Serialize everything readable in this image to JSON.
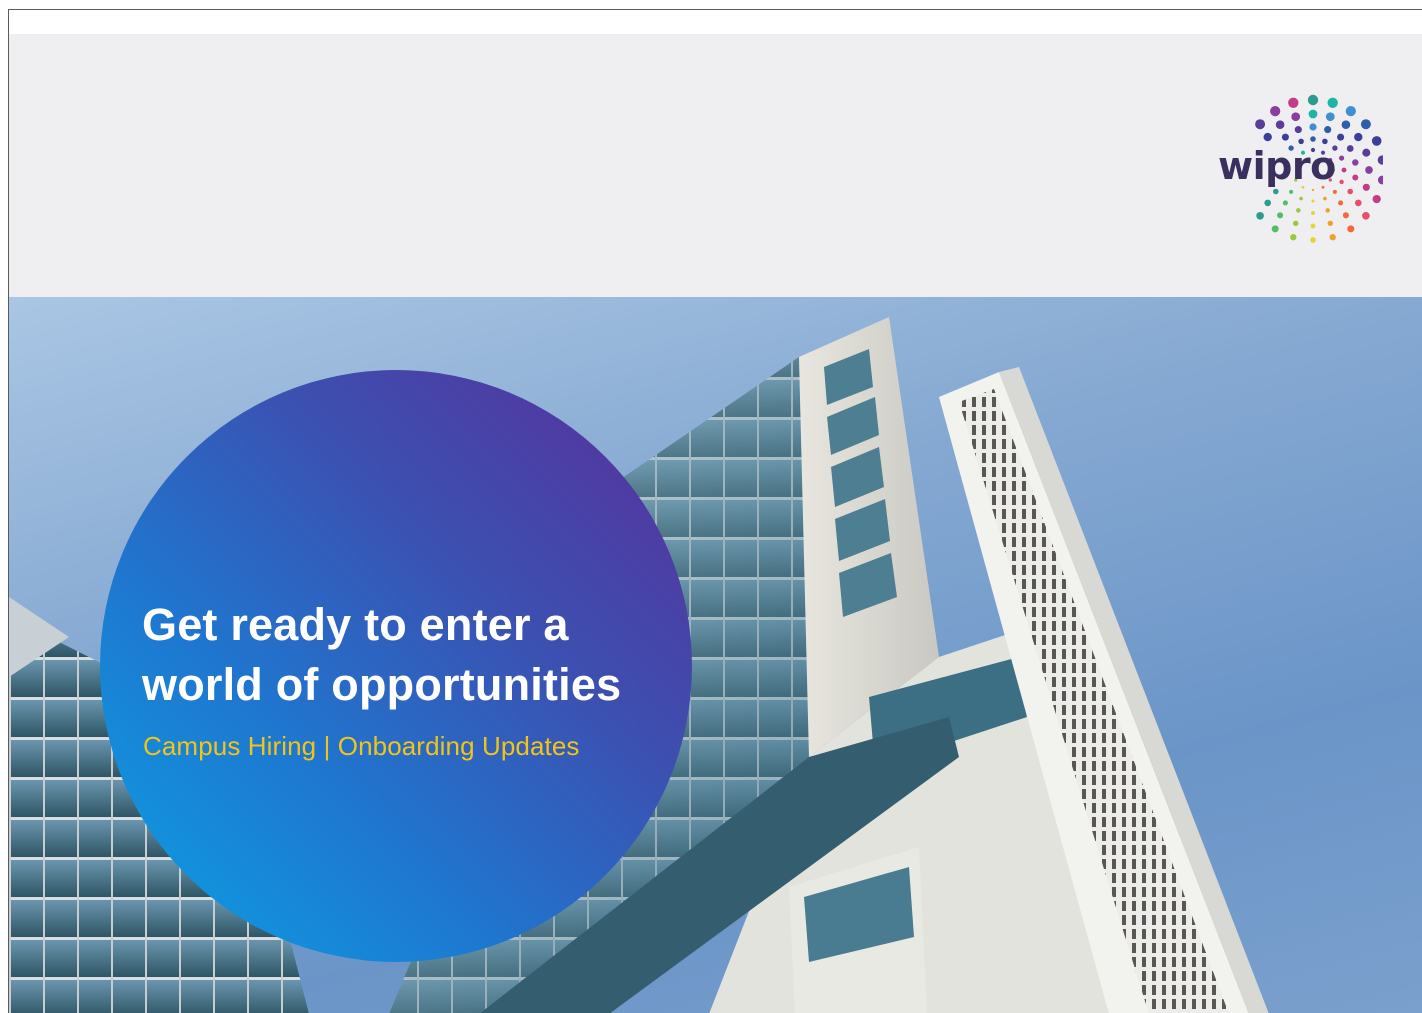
{
  "brand": {
    "name": "wipro",
    "logo_icon": "wipro-dot-spiral-logo",
    "colors": {
      "header_bg": "#efeef1",
      "headline": "#ffffff",
      "subline": "#f0c419",
      "circle_start": "#5b2d99",
      "circle_end": "#0aa4e4"
    }
  },
  "hero": {
    "headline_line1": "Get ready to enter a",
    "headline_line2": "world of opportunities",
    "subline": "Campus Hiring | Onboarding Updates",
    "background": "office-building-photo"
  }
}
